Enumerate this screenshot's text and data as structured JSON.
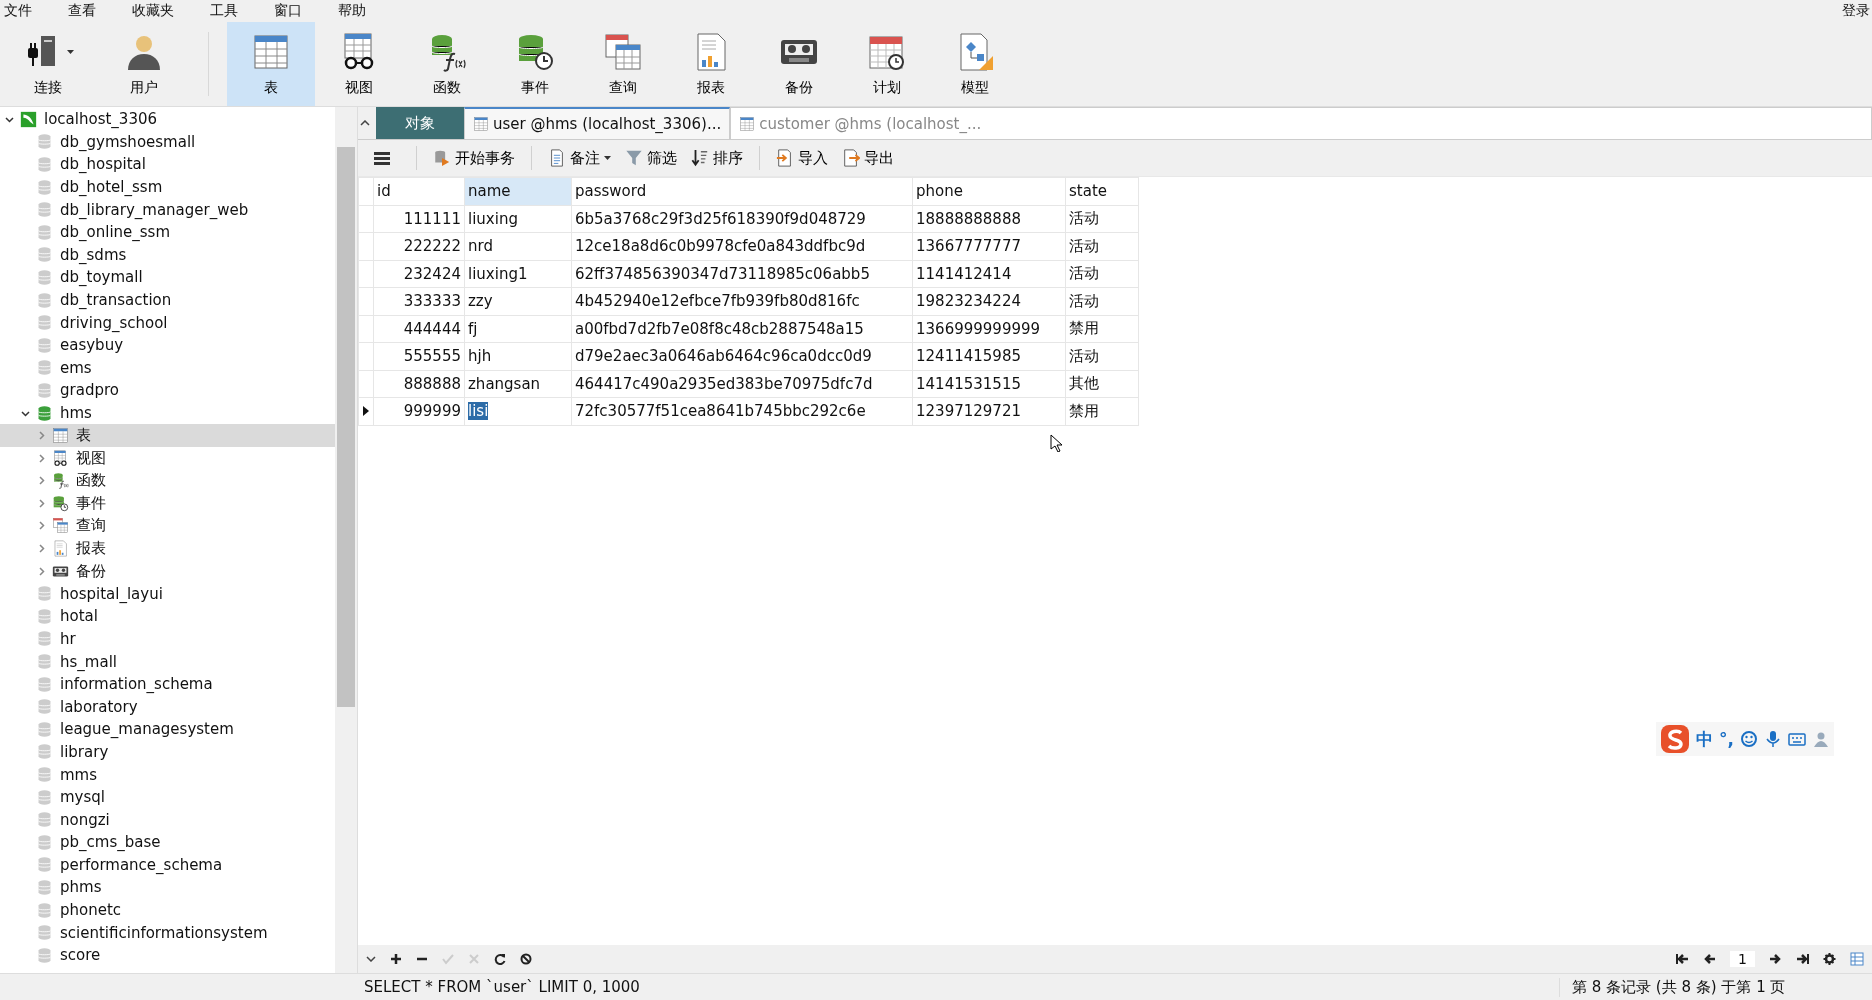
{
  "menu": [
    "文件",
    "查看",
    "收藏夹",
    "工具",
    "窗口",
    "帮助"
  ],
  "login": "登录",
  "toolbar": [
    {
      "label": "连接",
      "kind": "connect",
      "selected": false,
      "dropdown": true
    },
    {
      "label": "用户",
      "kind": "user",
      "selected": false,
      "dropdown": false
    },
    {
      "label": "表",
      "kind": "table",
      "selected": true,
      "dropdown": false
    },
    {
      "label": "视图",
      "kind": "view",
      "selected": false,
      "dropdown": false
    },
    {
      "label": "函数",
      "kind": "function",
      "selected": false,
      "dropdown": false
    },
    {
      "label": "事件",
      "kind": "event",
      "selected": false,
      "dropdown": false
    },
    {
      "label": "查询",
      "kind": "query",
      "selected": false,
      "dropdown": false
    },
    {
      "label": "报表",
      "kind": "report",
      "selected": false,
      "dropdown": false
    },
    {
      "label": "备份",
      "kind": "backup",
      "selected": false,
      "dropdown": false
    },
    {
      "label": "计划",
      "kind": "schedule",
      "selected": false,
      "dropdown": false
    },
    {
      "label": "模型",
      "kind": "model",
      "selected": false,
      "dropdown": false
    }
  ],
  "sidebar": {
    "tree": [
      {
        "label": "localhost_3306",
        "kind": "connection",
        "expanded": true,
        "selected": false,
        "children": [
          {
            "label": "db_gymshoesmall",
            "kind": "database",
            "selected": false
          },
          {
            "label": "db_hospital",
            "kind": "database",
            "selected": false
          },
          {
            "label": "db_hotel_ssm",
            "kind": "database",
            "selected": false
          },
          {
            "label": "db_library_manager_web",
            "kind": "database",
            "selected": false
          },
          {
            "label": "db_online_ssm",
            "kind": "database",
            "selected": false
          },
          {
            "label": "db_sdms",
            "kind": "database",
            "selected": false
          },
          {
            "label": "db_toymall",
            "kind": "database",
            "selected": false
          },
          {
            "label": "db_transaction",
            "kind": "database",
            "selected": false
          },
          {
            "label": "driving_school",
            "kind": "database",
            "selected": false
          },
          {
            "label": "easybuy",
            "kind": "database",
            "selected": false
          },
          {
            "label": "ems",
            "kind": "database",
            "selected": false
          },
          {
            "label": "gradpro",
            "kind": "database",
            "selected": false
          },
          {
            "label": "hms",
            "kind": "database-open",
            "expanded": true,
            "selected": false,
            "children": [
              {
                "label": "表",
                "kind": "table",
                "expanded": false,
                "selected": true
              },
              {
                "label": "视图",
                "kind": "view",
                "expanded": false,
                "selected": false
              },
              {
                "label": "函数",
                "kind": "function",
                "expanded": false,
                "selected": false
              },
              {
                "label": "事件",
                "kind": "event",
                "expanded": false,
                "selected": false
              },
              {
                "label": "查询",
                "kind": "query",
                "expanded": false,
                "selected": false
              },
              {
                "label": "报表",
                "kind": "report",
                "expanded": false,
                "selected": false
              },
              {
                "label": "备份",
                "kind": "backup",
                "expanded": false,
                "selected": false
              }
            ]
          },
          {
            "label": "hospital_layui",
            "kind": "database",
            "selected": false
          },
          {
            "label": "hotal",
            "kind": "database",
            "selected": false
          },
          {
            "label": "hr",
            "kind": "database",
            "selected": false
          },
          {
            "label": "hs_mall",
            "kind": "database",
            "selected": false
          },
          {
            "label": "information_schema",
            "kind": "database",
            "selected": false
          },
          {
            "label": "laboratory",
            "kind": "database",
            "selected": false
          },
          {
            "label": "league_managesystem",
            "kind": "database",
            "selected": false
          },
          {
            "label": "library",
            "kind": "database",
            "selected": false
          },
          {
            "label": "mms",
            "kind": "database",
            "selected": false
          },
          {
            "label": "mysql",
            "kind": "database",
            "selected": false
          },
          {
            "label": "nongzi",
            "kind": "database",
            "selected": false
          },
          {
            "label": "pb_cms_base",
            "kind": "database",
            "selected": false
          },
          {
            "label": "performance_schema",
            "kind": "database",
            "selected": false
          },
          {
            "label": "phms",
            "kind": "database",
            "selected": false
          },
          {
            "label": "phonetc",
            "kind": "database",
            "selected": false
          },
          {
            "label": "scientificinformationsystem",
            "kind": "database",
            "selected": false
          },
          {
            "label": "score",
            "kind": "database",
            "selected": false
          }
        ]
      }
    ]
  },
  "tabs": [
    {
      "label": "对象",
      "kind": "objects",
      "selected": false
    },
    {
      "label": "user @hms (localhost_3306)...",
      "kind": "table",
      "selected": true
    },
    {
      "label": "customer @hms (localhost_...",
      "kind": "table",
      "selected": false
    }
  ],
  "grid_toolbar": [
    {
      "label": "开始事务",
      "kind": "transaction",
      "dropdown": false
    },
    {
      "label": "备注",
      "kind": "note",
      "dropdown": true
    },
    {
      "label": "筛选",
      "kind": "filter",
      "dropdown": false
    },
    {
      "label": "排序",
      "kind": "sort",
      "dropdown": false
    },
    {
      "label": "导入",
      "kind": "import",
      "dropdown": false
    },
    {
      "label": "导出",
      "kind": "export",
      "dropdown": false
    }
  ],
  "table": {
    "columns": [
      {
        "label": "id",
        "selected": false
      },
      {
        "label": "name",
        "selected": true
      },
      {
        "label": "password",
        "selected": false
      },
      {
        "label": "phone",
        "selected": false
      },
      {
        "label": "state",
        "selected": false
      }
    ],
    "rows": [
      {
        "current": false,
        "cells": [
          {
            "text": "111111",
            "selected": false
          },
          {
            "text": "liuxing",
            "selected": false
          },
          {
            "text": "6b5a3768c29f3d25f618390f9d048729",
            "selected": false
          },
          {
            "text": "18888888888",
            "selected": false
          },
          {
            "text": "活动",
            "selected": false
          }
        ]
      },
      {
        "current": false,
        "cells": [
          {
            "text": "222222",
            "selected": false
          },
          {
            "text": "nrd",
            "selected": false
          },
          {
            "text": "12ce18a8d6c0b9978cfe0a843ddfbc9d",
            "selected": false
          },
          {
            "text": "13667777777",
            "selected": false
          },
          {
            "text": "活动",
            "selected": false
          }
        ]
      },
      {
        "current": false,
        "cells": [
          {
            "text": "232424",
            "selected": false
          },
          {
            "text": "liuxing1",
            "selected": false
          },
          {
            "text": "62ff374856390347d73118985c06abb5",
            "selected": false
          },
          {
            "text": "1141412414",
            "selected": false
          },
          {
            "text": "活动",
            "selected": false
          }
        ]
      },
      {
        "current": false,
        "cells": [
          {
            "text": "333333",
            "selected": false
          },
          {
            "text": "zzy",
            "selected": false
          },
          {
            "text": "4b452940e12efbce7fb939fb80d816fc",
            "selected": false
          },
          {
            "text": "19823234224",
            "selected": false
          },
          {
            "text": "活动",
            "selected": false
          }
        ]
      },
      {
        "current": false,
        "cells": [
          {
            "text": "444444",
            "selected": false
          },
          {
            "text": "fj",
            "selected": false
          },
          {
            "text": "a00fbd7d2fb7e08f8c48cb2887548a15",
            "selected": false
          },
          {
            "text": "1366999999999",
            "selected": false
          },
          {
            "text": "禁用",
            "selected": false
          }
        ]
      },
      {
        "current": false,
        "cells": [
          {
            "text": "555555",
            "selected": false
          },
          {
            "text": "hjh",
            "selected": false
          },
          {
            "text": "d79e2aec3a0646ab6464c96ca0dcc0d9",
            "selected": false
          },
          {
            "text": "12411415985",
            "selected": false
          },
          {
            "text": "活动",
            "selected": false
          }
        ]
      },
      {
        "current": false,
        "cells": [
          {
            "text": "888888",
            "selected": false
          },
          {
            "text": "zhangsan",
            "selected": false
          },
          {
            "text": "464417c490a2935ed383be70975dfc7d",
            "selected": false
          },
          {
            "text": "14141531515",
            "selected": false
          },
          {
            "text": "其他",
            "selected": false
          }
        ]
      },
      {
        "current": true,
        "cells": [
          {
            "text": "999999",
            "selected": false
          },
          {
            "text": "lisi",
            "selected": true
          },
          {
            "text": "72fc30577f51cea8641b745bbc292c6e",
            "selected": false
          },
          {
            "text": "12397129721",
            "selected": false
          },
          {
            "text": "禁用",
            "selected": false
          }
        ]
      }
    ]
  },
  "pager": {
    "page": "1"
  },
  "ime": {
    "mode": "中",
    "punctuation": "°,"
  },
  "status_bar": {
    "sql": "SELECT * FROM `user` LIMIT 0, 1000",
    "records": "第 8 条记录 (共 8 条) 于第 1 页"
  }
}
